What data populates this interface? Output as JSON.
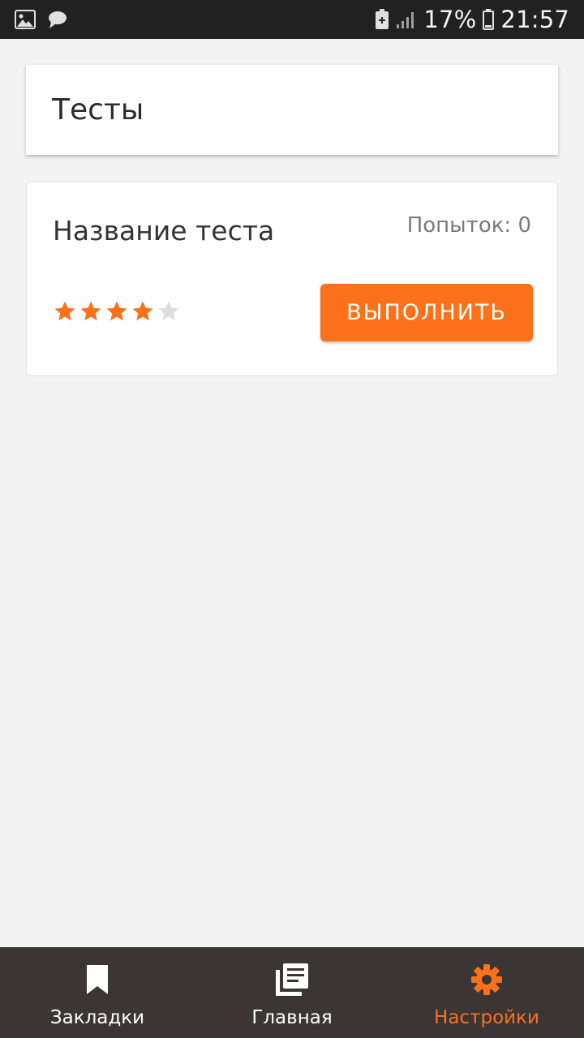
{
  "status_bar": {
    "battery_percent": "17%",
    "time": "21:57",
    "icons": [
      "image-icon",
      "chat-icon",
      "battery-saver-icon",
      "signal-icon",
      "battery-icon"
    ]
  },
  "header": {
    "title": "Тесты"
  },
  "test_card": {
    "name": "Название теста",
    "attempts": "Попыток: 0",
    "rating": 4,
    "rating_max": 5,
    "run_label": "ВЫПОЛНИТЬ"
  },
  "bottom_nav": {
    "items": [
      {
        "label": "Закладки",
        "icon": "bookmark-icon",
        "active": false
      },
      {
        "label": "Главная",
        "icon": "news-icon",
        "active": false
      },
      {
        "label": "Настройки",
        "icon": "gear-icon",
        "active": true
      }
    ]
  },
  "colors": {
    "accent": "#fc7119",
    "star_off": "#dddddd",
    "nav_bg": "#3b3535",
    "status_bg": "#212121"
  }
}
